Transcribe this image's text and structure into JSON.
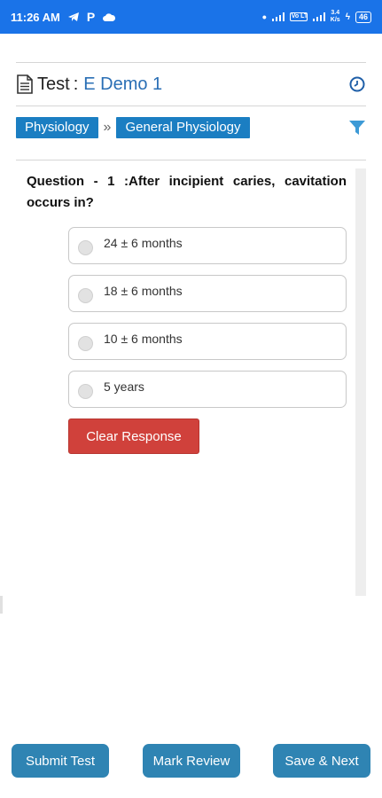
{
  "status_bar": {
    "time": "11:26 AM",
    "speed_value": "3.4",
    "speed_unit": "K/s",
    "battery": "46",
    "network": "Vo LTE"
  },
  "header": {
    "test_label": "Test",
    "separator": ":",
    "test_name": "E Demo 1"
  },
  "breadcrumb": {
    "subject": "Physiology",
    "separator": "»",
    "topic": "General Physiology"
  },
  "question": {
    "text": "Question - 1 :After incipient caries, cavitation occurs in?",
    "options": [
      {
        "label": "24 ± 6 months"
      },
      {
        "label": "18 ± 6 months"
      },
      {
        "label": "10 ± 6 months"
      },
      {
        "label": "5 years"
      }
    ],
    "clear_label": "Clear Response"
  },
  "footer": {
    "submit_label": "Submit Test",
    "review_label": "Mark Review",
    "next_label": "Save & Next"
  },
  "colors": {
    "status_bar": "#1a73e8",
    "tag": "#1b7ec2",
    "clear_button": "#d0413b",
    "bottom_button": "#2f84b3"
  }
}
